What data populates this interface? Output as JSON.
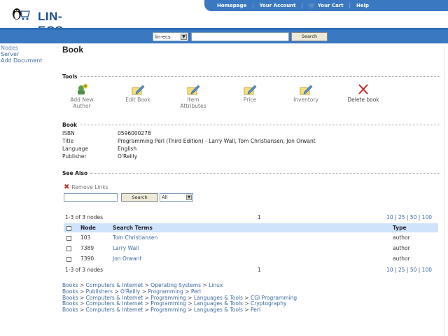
{
  "header": {
    "logo_text": "LIN-ECS",
    "nav": [
      "Homepage",
      "Your Account",
      "Your Cart",
      "Help"
    ]
  },
  "search": {
    "scope_value": "lin-ecs",
    "input_value": "",
    "button_label": "Search"
  },
  "leftnav": [
    "Nodes",
    "Server",
    "Add Document"
  ],
  "page_title": "Book",
  "tools": {
    "heading": "Tools",
    "items": [
      {
        "label": "Add New Author",
        "icon": "add-user-icon"
      },
      {
        "label": "Edit Book",
        "icon": "edit-book-icon"
      },
      {
        "label": "Item Attributes",
        "icon": "item-attributes-icon"
      },
      {
        "label": "Price",
        "icon": "price-icon"
      },
      {
        "label": "Inventory",
        "icon": "inventory-icon"
      },
      {
        "label": "Delete book",
        "icon": "delete-x-icon"
      }
    ]
  },
  "book": {
    "heading": "Book",
    "fields": [
      {
        "key": "ISBN",
        "value": "0596000278"
      },
      {
        "key": "Title",
        "value": "Programming Perl (Third Edition) - Larry Wall, Tom Christiansen, Jon Orwant"
      },
      {
        "key": "Language",
        "value": "English"
      },
      {
        "key": "Publisher",
        "value": "O'Reilly"
      }
    ]
  },
  "see_also": {
    "heading": "See Also",
    "remove_links_label": "Remove Links",
    "filter_input_value": "",
    "filter_button_label": "Search",
    "filter_select_value": "All"
  },
  "pager": {
    "count_text": "1-3 of 3 nodes",
    "page": "1",
    "sizes": [
      "10",
      "25",
      "50",
      "100"
    ]
  },
  "table": {
    "headers": [
      "Node",
      "Search Terms",
      "Type"
    ],
    "rows": [
      {
        "node": "103",
        "term": "Tom Christiansen",
        "type": "author"
      },
      {
        "node": "7389",
        "term": "Larry Wall",
        "type": "author"
      },
      {
        "node": "7390",
        "term": "Jon Orwant",
        "type": "author"
      }
    ]
  },
  "breadcrumbs": [
    [
      "Books",
      "Computers & Internet",
      "Operating Systems",
      "Linux"
    ],
    [
      "Books",
      "Publishers",
      "O'Reilly",
      "Programming",
      "Perl"
    ],
    [
      "Books",
      "Computers & Internet",
      "Programming",
      "Languages & Tools",
      "CGI Programming"
    ],
    [
      "Books",
      "Computers & Internet",
      "Programming",
      "Languages & Tools",
      "Cryptography"
    ],
    [
      "Books",
      "Computers & Internet",
      "Programming",
      "Languages & Tools",
      "Perl"
    ]
  ],
  "colors": {
    "brand_blue": "#3a78c2",
    "link_blue": "#3b6aa0",
    "table_header": "#cfe3fb",
    "delete_red": "#d03030"
  }
}
